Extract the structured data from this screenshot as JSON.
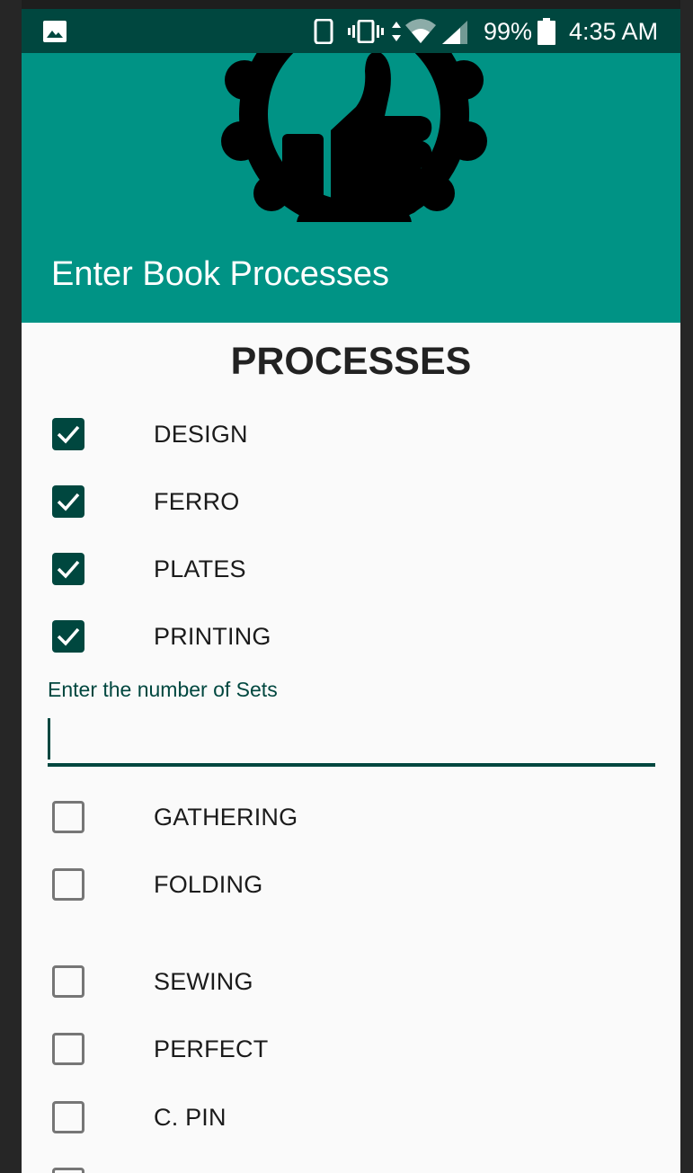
{
  "status_bar": {
    "battery_percent": "99%",
    "time": "4:35 AM",
    "icons": [
      "gallery-icon",
      "phone-icon",
      "vibrate-icon",
      "data-arrows-icon",
      "wifi-icon",
      "signal-icon",
      "battery-icon"
    ]
  },
  "app_bar": {
    "title": "Enter Book Processes",
    "logo_icon": "thumbs-up-badge-icon",
    "background_color": "#009385"
  },
  "processes": {
    "heading": "PROCESSES",
    "checked_group": [
      {
        "label": "DESIGN",
        "checked": true
      },
      {
        "label": "FERRO",
        "checked": true
      },
      {
        "label": "PLATES",
        "checked": true
      },
      {
        "label": "PRINTING",
        "checked": true
      }
    ],
    "sets_field": {
      "label": "Enter the number of Sets",
      "value": ""
    },
    "unchecked_group": [
      {
        "label": "GATHERING",
        "checked": false
      },
      {
        "label": "FOLDING",
        "checked": false
      },
      {
        "label": "SEWING",
        "checked": false
      },
      {
        "label": "PERFECT",
        "checked": false
      },
      {
        "label": "C. PIN",
        "checked": false
      }
    ]
  },
  "colors": {
    "primary_dark": "#00473f",
    "primary": "#009385",
    "checkbox_unchecked": "#767676"
  }
}
